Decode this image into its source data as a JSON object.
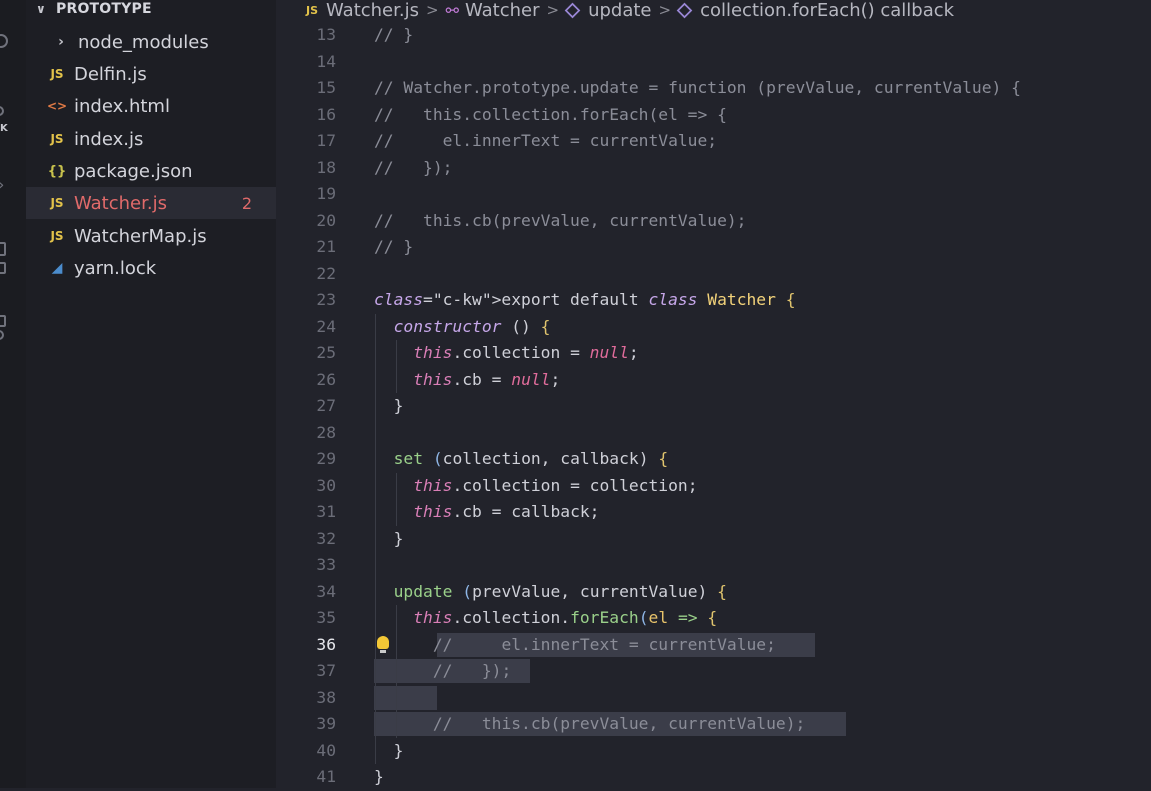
{
  "activity_bar": {
    "partial_label": "K"
  },
  "sidebar": {
    "section_title": "PROTOTYPE",
    "items": [
      {
        "label": "node_modules",
        "icon": "folder-chevron"
      },
      {
        "label": "Delfin.js",
        "icon": "js"
      },
      {
        "label": "index.html",
        "icon": "html"
      },
      {
        "label": "index.js",
        "icon": "js"
      },
      {
        "label": "package.json",
        "icon": "json"
      },
      {
        "label": "Watcher.js",
        "icon": "js",
        "badge": "2",
        "selected": true
      },
      {
        "label": "WatcherMap.js",
        "icon": "js"
      },
      {
        "label": "yarn.lock",
        "icon": "yarn"
      }
    ],
    "icon_glyphs": {
      "js": "JS",
      "html": "<>",
      "json": "{}"
    }
  },
  "breadcrumb": {
    "file": "Watcher.js",
    "file_icon": "JS",
    "class": "Watcher",
    "method": "update",
    "callback": "collection.forEach() callback"
  },
  "editor": {
    "active_line": 36,
    "lines": [
      {
        "n": "13",
        "text": "// }"
      },
      {
        "n": "14",
        "text": ""
      },
      {
        "n": "15",
        "text": "// Watcher.prototype.update = function (prevValue, currentValue) {"
      },
      {
        "n": "16",
        "text": "//   this.collection.forEach(el => {"
      },
      {
        "n": "17",
        "text": "//     el.innerText = currentValue;"
      },
      {
        "n": "18",
        "text": "//   });"
      },
      {
        "n": "19",
        "text": ""
      },
      {
        "n": "20",
        "text": "//   this.cb(prevValue, currentValue);"
      },
      {
        "n": "21",
        "text": "// }"
      },
      {
        "n": "22",
        "text": ""
      },
      {
        "n": "23",
        "text": "export default class Watcher {"
      },
      {
        "n": "24",
        "text": "  constructor () {"
      },
      {
        "n": "25",
        "text": "    this.collection = null;"
      },
      {
        "n": "26",
        "text": "    this.cb = null;"
      },
      {
        "n": "27",
        "text": "  }"
      },
      {
        "n": "28",
        "text": ""
      },
      {
        "n": "29",
        "text": "  set (collection, callback) {"
      },
      {
        "n": "30",
        "text": "    this.collection = collection;"
      },
      {
        "n": "31",
        "text": "    this.cb = callback;"
      },
      {
        "n": "32",
        "text": "  }"
      },
      {
        "n": "33",
        "text": ""
      },
      {
        "n": "34",
        "text": "  update (prevValue, currentValue) {"
      },
      {
        "n": "35",
        "text": "    this.collection.forEach(el => {"
      },
      {
        "n": "36",
        "text": "      //     el.innerText = currentValue;"
      },
      {
        "n": "37",
        "text": "      //   });"
      },
      {
        "n": "38",
        "text": ""
      },
      {
        "n": "39",
        "text": "      //   this.cb(prevValue, currentValue);"
      },
      {
        "n": "40",
        "text": "  }"
      },
      {
        "n": "41",
        "text": "}"
      }
    ]
  },
  "colors": {
    "editor_bg": "#22232b",
    "sidebar_bg": "#1d1e24",
    "selection": "#3b3d49",
    "error": "#e06a6a",
    "js_icon": "#e2c24a"
  }
}
